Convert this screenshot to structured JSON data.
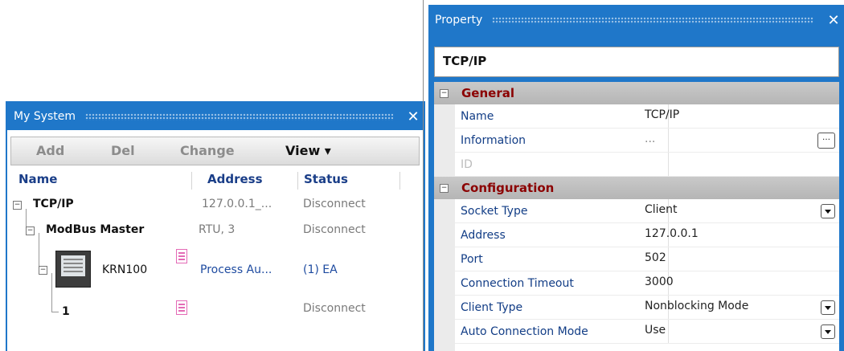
{
  "my_system": {
    "title": "My System",
    "toolbar": {
      "add": "Add",
      "del": "Del",
      "change": "Change",
      "view": "View ▾"
    },
    "columns": {
      "name": "Name",
      "address": "Address",
      "status": "Status"
    },
    "tree": [
      {
        "name": "TCP/IP",
        "address": "127.0.0.1_...",
        "status": "Disconnect"
      },
      {
        "name": "ModBus Master",
        "address": "RTU, 3",
        "status": "Disconnect"
      },
      {
        "name": "KRN100",
        "address": "Process Au...",
        "status": "(1) EA"
      },
      {
        "name": "1",
        "address": "",
        "status": "Disconnect"
      }
    ]
  },
  "property": {
    "title": "Property",
    "selected": "TCP/IP",
    "categories": [
      {
        "label": "General",
        "items": [
          {
            "key": "Name",
            "value": "TCP/IP"
          },
          {
            "key": "Information",
            "value": "..."
          },
          {
            "key": "ID",
            "value": ""
          }
        ]
      },
      {
        "label": "Configuration",
        "items": [
          {
            "key": "Socket Type",
            "value": "Client"
          },
          {
            "key": "Address",
            "value": "127.0.0.1"
          },
          {
            "key": "Port",
            "value": "502"
          },
          {
            "key": "Connection Timeout",
            "value": "3000"
          },
          {
            "key": "Client Type",
            "value": "Nonblocking Mode"
          },
          {
            "key": "Auto Connection Mode",
            "value": "Use"
          }
        ]
      }
    ]
  },
  "colors": {
    "titlebar": "#1f77c9",
    "category_text": "#8b0000",
    "key_text": "#123d86",
    "column_header": "#1a3e88",
    "row_icon": "#e46ab6"
  },
  "icons": {
    "close": "close-icon",
    "expand": "minus-box-icon",
    "device": "krn100-device-icon",
    "doc": "document-icon",
    "dropdown": "dropdown-arrow-icon",
    "ellipsis": "ellipsis-button-icon"
  }
}
